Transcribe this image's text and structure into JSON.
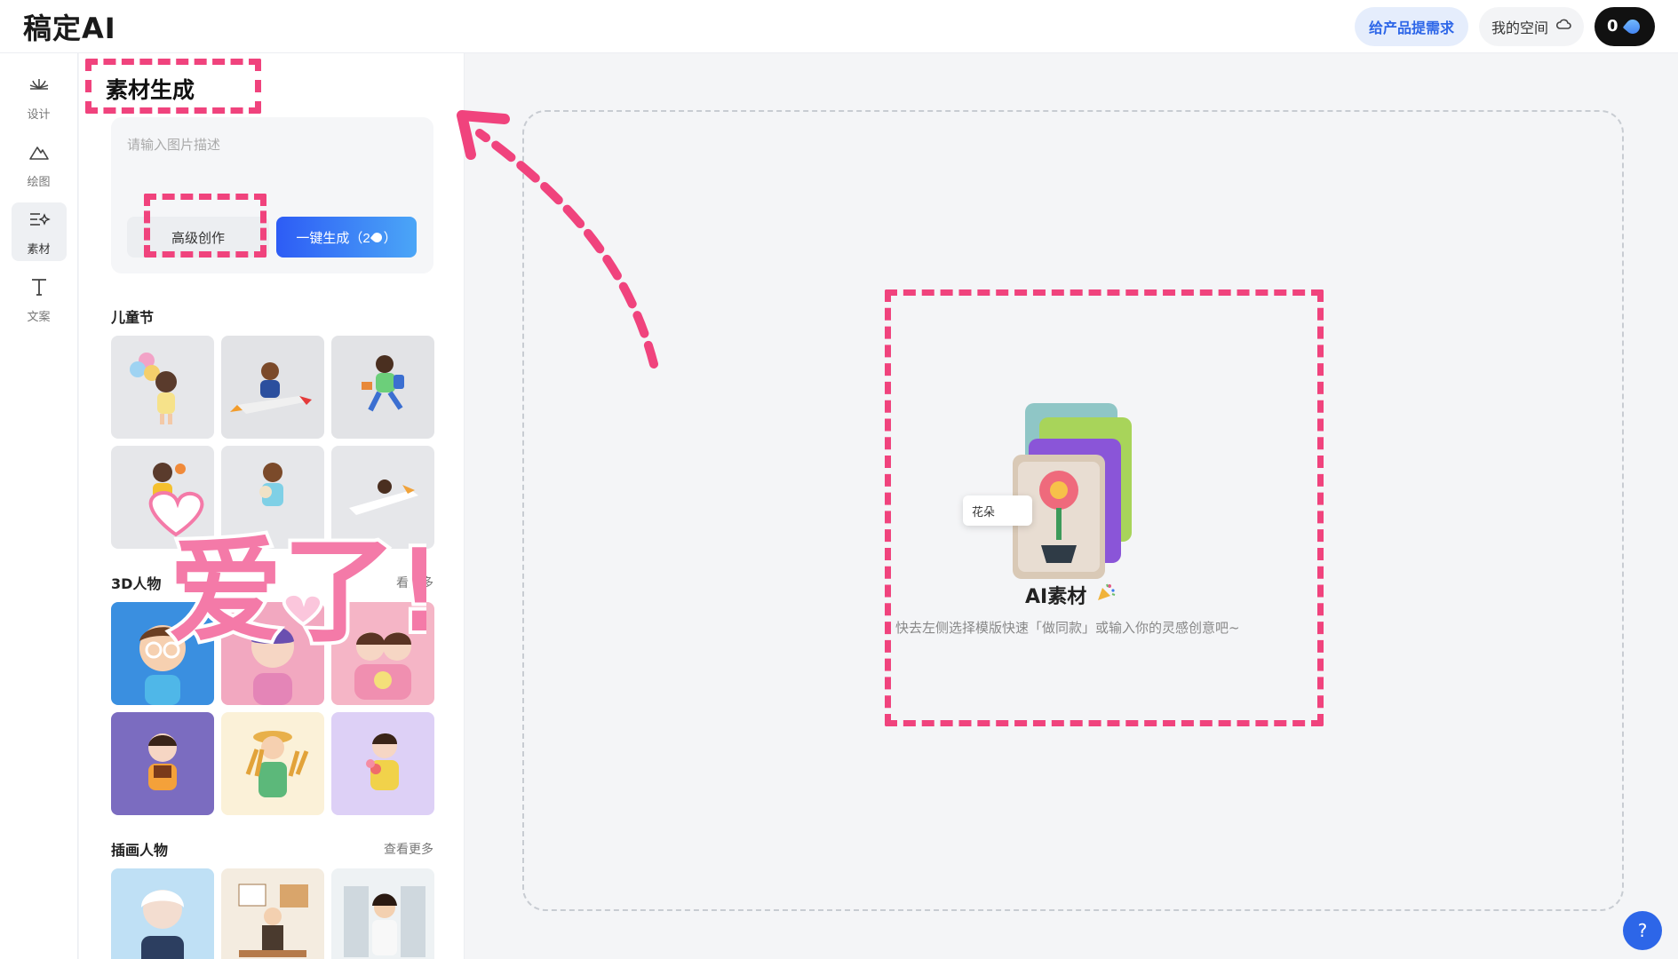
{
  "app": {
    "logo": "稿定AI"
  },
  "header": {
    "feedback_label": "给产品提需求",
    "space_label": "我的空间",
    "credits": "0"
  },
  "rail": [
    {
      "label": "设计",
      "icon": "lotus-icon"
    },
    {
      "label": "绘图",
      "icon": "mountain-icon"
    },
    {
      "label": "素材",
      "icon": "sparkle-list-icon"
    },
    {
      "label": "文案",
      "icon": "text-icon"
    }
  ],
  "panel": {
    "title": "素材生成",
    "prompt_placeholder": "请输入图片描述",
    "advanced_label": "高级创作",
    "generate_label": "一键生成（2",
    "generate_tail": "）",
    "sections": [
      {
        "title": "儿童节",
        "more": ""
      },
      {
        "title": "3D人物",
        "more": "看更多"
      },
      {
        "title": "插画人物",
        "more": "查看更多"
      }
    ]
  },
  "overlay": {
    "sticker_text": "爱了!"
  },
  "canvas": {
    "chip": "花朵",
    "title": "AI素材",
    "description": "快去左侧选择模版快速「做同款」或输入你的灵感创意吧~"
  },
  "help": {
    "label": "?"
  },
  "colors": {
    "accent": "#2d66e8",
    "highlight": "#f0437d"
  }
}
